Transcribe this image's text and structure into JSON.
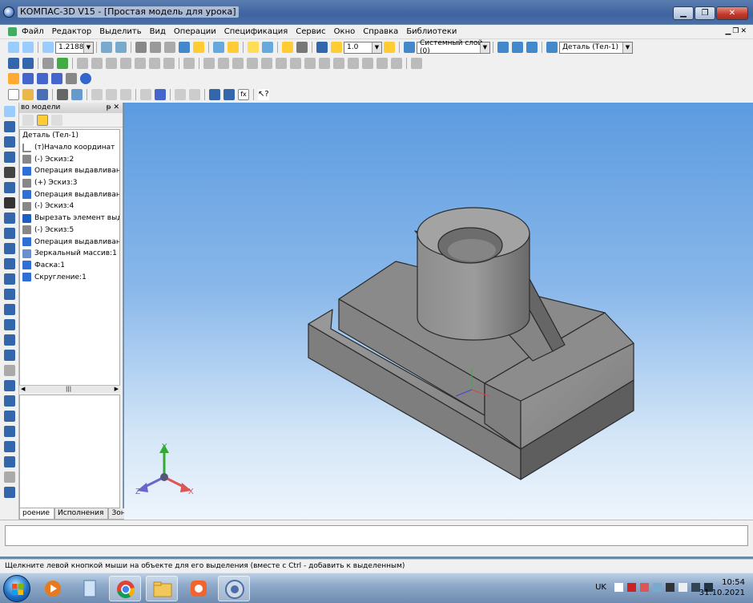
{
  "window": {
    "title": "КОМПАС-3D V15 - [Простая модель для урока]"
  },
  "menu": [
    "Файл",
    "Редактор",
    "Выделить",
    "Вид",
    "Операции",
    "Спецификация",
    "Сервис",
    "Окно",
    "Справка",
    "Библиотеки"
  ],
  "toolbar": {
    "zoom_value": "1.2188",
    "step_value": "1.0",
    "layer": "Системный слой (0)",
    "part": "Деталь (Тел-1)"
  },
  "tree_panel": {
    "header": "во модели",
    "items": [
      "Деталь (Тел-1)",
      "(т)Начало координат",
      "(-) Эскиз:2",
      "Операция выдавливания",
      "(+) Эскиз:3",
      "Операция выдавливания",
      "(-) Эскиз:4",
      "Вырезать элемент выдав.",
      "(-) Эскиз:5",
      "Операция выдавливания",
      "Зеркальный массив:1",
      "Фаска:1",
      "Скругление:1"
    ],
    "tabs": [
      "роение",
      "Исполнения",
      "Зоны"
    ]
  },
  "viewport": {
    "axis_x": "X",
    "axis_y": "Y",
    "axis_z": "Z"
  },
  "status": {
    "hint": "Щелкните левой кнопкой мыши на объекте для его выделения (вместе с Ctrl - добавить к выделенным)"
  },
  "taskbar": {
    "lang": "UK",
    "time": "10:54",
    "date": "31.10.2021"
  },
  "colors": {
    "accent": "#3f63a0",
    "viewport_top": "#5c9be0",
    "model": "#8c8c8c"
  }
}
